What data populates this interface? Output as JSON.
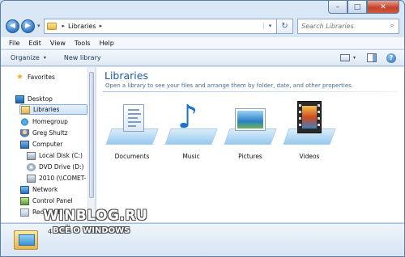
{
  "window": {
    "caption_minimize": "–",
    "caption_maximize": "□",
    "caption_close": "✕"
  },
  "address": {
    "back": "◀",
    "forward": "▶",
    "history_caret": "▾",
    "separator": "▸",
    "path": "Libraries",
    "path_separator": "▸",
    "dropdown": "▾",
    "refresh": "↻",
    "search_placeholder": "Search Libraries",
    "search_icon": "search-icon"
  },
  "menu": [
    "File",
    "Edit",
    "View",
    "Tools",
    "Help"
  ],
  "toolbar": {
    "organize": "Organize",
    "organize_caret": "▾",
    "new_library": "New library",
    "view_caret": "▾",
    "help": "?"
  },
  "nav": {
    "favorites": "Favorites",
    "desktop": "Desktop",
    "libraries": "Libraries",
    "homegroup": "Homegroup",
    "user": "Greg Shultz",
    "computer": "Computer",
    "local_disk": "Local Disk (C:)",
    "dvd": "DVD Drive (D:)",
    "share": "2010 (\\\\COMET-",
    "network": "Network",
    "control_panel": "Control Panel",
    "recycle_bin": "Recycle Bin"
  },
  "content": {
    "title": "Libraries",
    "subtitle": "Open a library to see your files and arrange them by folder, date, and other properties.",
    "libraries": [
      "Documents",
      "Music",
      "Pictures",
      "Videos"
    ]
  },
  "details": {
    "count": "4 items"
  },
  "watermark": {
    "line1": "WINBLOG.RU",
    "line2": "ВСЁ О WINDOWS"
  },
  "colors": {
    "accent": "#1e5ca8",
    "selection": "#cfe4f7",
    "close_button": "#c4432b"
  }
}
